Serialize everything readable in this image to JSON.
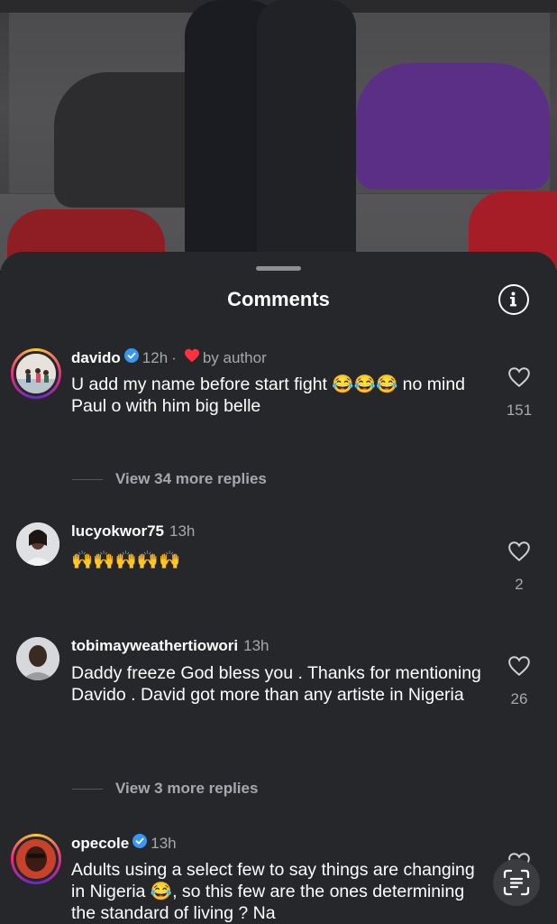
{
  "sheet": {
    "title": "Comments"
  },
  "comments": [
    {
      "username": "davido",
      "verified": true,
      "time": "12h",
      "separator": "·",
      "liked_by_author_label": "by author",
      "text": "U add my name before start fight 😂😂😂 no mind Paul o with him big belle",
      "likes": "151",
      "view_replies": "View 34 more replies"
    },
    {
      "username": "lucyokwor75",
      "verified": false,
      "time": "13h",
      "text": "🙌🙌🙌🙌🙌",
      "likes": "2"
    },
    {
      "username": "tobimayweathertiowori",
      "verified": false,
      "time": "13h",
      "text": "Daddy freeze God bless you . Thanks for mentioning Davido . David got more than any artiste in Nigeria",
      "likes": "26",
      "view_replies": "View 3 more replies"
    },
    {
      "username": "opecole",
      "verified": true,
      "time": "13h",
      "text": "Adults using a select few to say things are changing in Nigeria 😂, so this few are the ones determining the standard of living ? Na"
    }
  ],
  "colors": {
    "sheet_bg": "#25272b",
    "muted_text": "#a7a8ad",
    "verified_blue": "#3897f0",
    "heart_red": "#ff3040"
  },
  "icons": [
    "info-icon",
    "verified-badge-icon",
    "heart-icon",
    "heart-outline-icon",
    "text-scan-icon"
  ]
}
